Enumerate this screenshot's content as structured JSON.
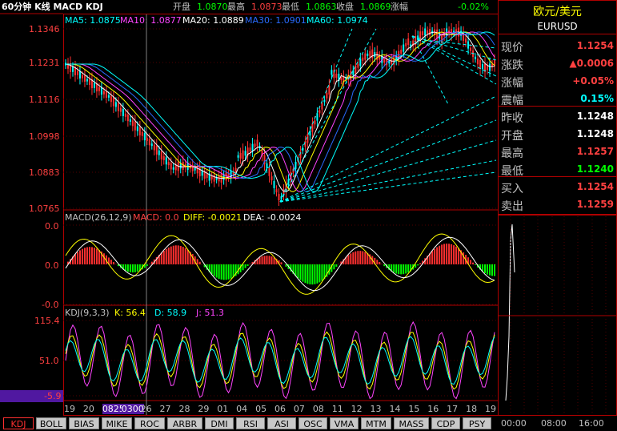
{
  "header": {
    "title": "60分钟 K线 MACD KDJ",
    "open_label": "开盘",
    "open_value": "1.0870",
    "high_label": "最高",
    "high_value": "1.0873",
    "low_label": "最低",
    "low_value": "1.0863",
    "close_label": "收盘",
    "close_value": "1.0869",
    "change_label": "涨幅",
    "change_value": "-0.02%"
  },
  "ma": [
    {
      "label": "MA5: 1.0875",
      "color": "#00ffff"
    },
    {
      "label": "MA10: 1.0877",
      "color": "#ff44ff"
    },
    {
      "label": "MA20: 1.0889",
      "color": "#ffffff"
    },
    {
      "label": "MA30: 1.0901",
      "color": "#2a6bff"
    },
    {
      "label": "MA60: 1.0974",
      "color": "#00ffff"
    }
  ],
  "price_axis": [
    "1.1346",
    "1.1231",
    "1.1116",
    "1.0998",
    "1.0883",
    "1.0765"
  ],
  "macd": {
    "title": "MACD(26,12,9)",
    "macd_label": "MACD: 0.0",
    "diff_label": "DIFF: -0.0021",
    "dea_label": "DEA: -0.0024",
    "axis": [
      "0.0",
      "0.0",
      "-0.0"
    ]
  },
  "kdj": {
    "title": "KDJ(9,3,3)",
    "k_label": "K: 56.4",
    "d_label": "D: 58.9",
    "j_label": "J: 51.3",
    "axis": [
      "115.4",
      "51.0",
      "-5.9"
    ]
  },
  "dates": [
    "19",
    "20",
    "0825",
    "0300",
    "26",
    "27",
    "28",
    "29",
    "01",
    "04",
    "05",
    "06",
    "07",
    "08",
    "11",
    "12",
    "13",
    "14",
    "15",
    "16",
    "17",
    "18",
    "19"
  ],
  "quote": {
    "name": "欧元/美元",
    "code": "EURUSD",
    "rows": [
      {
        "label": "现价",
        "value": "1.1254",
        "color": "#ff4040"
      },
      {
        "label": "涨跌",
        "value": "▲0.0006",
        "color": "#ff4040"
      },
      {
        "label": "涨幅",
        "value": "+0.05%",
        "color": "#ff4040"
      },
      {
        "label": "震幅",
        "value": "0.15%",
        "color": "#00ffff"
      },
      {
        "label": "昨收",
        "value": "1.1248",
        "color": "#ffffff"
      },
      {
        "label": "开盘",
        "value": "1.1248",
        "color": "#ffffff"
      },
      {
        "label": "最高",
        "value": "1.1257",
        "color": "#ff4040"
      },
      {
        "label": "最低",
        "value": "1.1240",
        "color": "#00ff00"
      },
      {
        "label": "买入",
        "value": "1.1254",
        "color": "#ff4040"
      },
      {
        "label": "卖出",
        "value": "1.1259",
        "color": "#ff4040"
      }
    ]
  },
  "mini_axis": [
    "00:00",
    "08:00",
    "16:00"
  ],
  "tabs": [
    "KDJ",
    "BOLL",
    "BIAS",
    "MIKE",
    "ROC",
    "ARBR",
    "DMI",
    "RSI",
    "ASI",
    "OSC",
    "VMA",
    "MTM",
    "MASS",
    "CDP",
    "PSY"
  ],
  "active_tab": "KDJ",
  "colors": {
    "up": "#ff3030",
    "down": "#00ffff",
    "frame": "#b00000",
    "grid": "#600000"
  }
}
